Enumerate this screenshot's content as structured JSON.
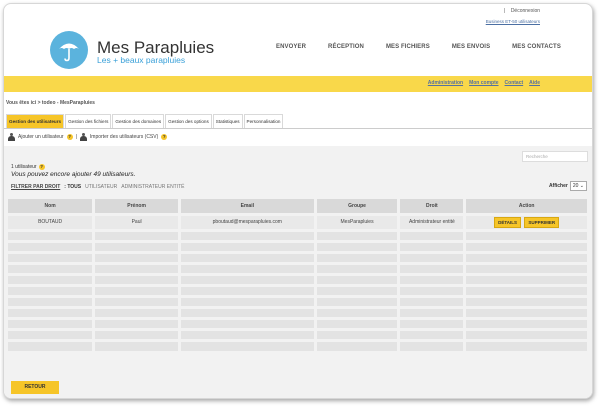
{
  "top": {
    "separator": "|",
    "logout": "Déconnexion",
    "plan": "Business ET-50 utilisateurs"
  },
  "brand": {
    "title": "Mes Parapluies",
    "tagline": "Les +  beaux parapluies"
  },
  "nav": [
    "ENVOYER",
    "RÉCEPTION",
    "MES FICHIERS",
    "MES ENVOIS",
    "MES CONTACTS"
  ],
  "admin_links": [
    "Administration",
    "Mon compte",
    "Contact",
    "Aide"
  ],
  "breadcrumb": "Vous êtes ici > todeo - MesParapluies",
  "tabs": [
    "Gestion des utilisateurs",
    "Gestion des fichiers",
    "Gestion des domaines",
    "Gestion des options",
    "Statistiques",
    "Personnalisation"
  ],
  "actions": {
    "add_user": "Ajouter un utilisateur",
    "sep": "|",
    "import": "Importer des utilisateurs (CSV)",
    "help": "?"
  },
  "search": {
    "placeholder": "Recherche"
  },
  "count": "1 utilisateur",
  "remaining": "Vous pouvez encore ajouter 49 utilisateurs.",
  "filters": {
    "label": "FILTRER PAR DROIT",
    "options": [
      ": TOUS",
      "UTILISATEUR",
      "ADMINISTRATEUR ENTITÉ"
    ]
  },
  "afficher": {
    "label": "Afficher",
    "value": "20"
  },
  "table": {
    "headers": [
      "Nom",
      "Prénom",
      "Email",
      "Groupe",
      "Droit",
      "Action"
    ],
    "rows": [
      {
        "nom": "BOUTAUD",
        "prenom": "Paul",
        "email": "pboutaud@mesparapluies.com",
        "groupe": "MesParapluies",
        "droit": "Administrateur entité",
        "details": "DÉTAILS",
        "supprimer": "SUPPRIMER"
      }
    ]
  },
  "back_button": "RETOUR",
  "colors": {
    "accent": "#f9d84a",
    "button": "#f6c528",
    "logo": "#5bb3dd"
  }
}
